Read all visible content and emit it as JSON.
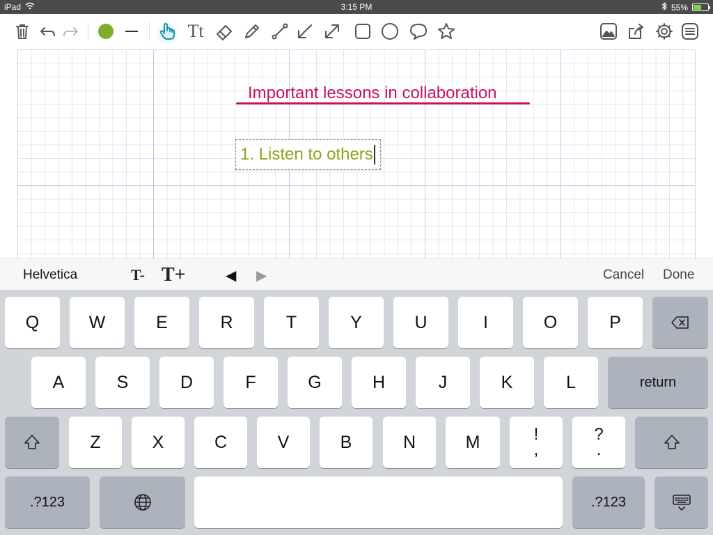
{
  "status_bar": {
    "device": "iPad",
    "time": "3:15 PM",
    "battery": "55%",
    "battery_level": 0.55
  },
  "toolbar": {
    "icons": [
      "trash-icon",
      "undo-icon",
      "redo-icon",
      "color-picker",
      "stroke-width",
      "hand-pointer-icon",
      "text-tool-icon",
      "eraser-icon",
      "pencil-icon",
      "line-icon",
      "arrow-icon",
      "double-arrow-icon",
      "rectangle-icon",
      "circle-icon",
      "speech-bubble-icon",
      "star-icon",
      "image-icon",
      "share-icon",
      "gear-icon",
      "menu-icon"
    ],
    "text_tool_label": "Tt",
    "current_color": "#7fac2a"
  },
  "canvas": {
    "title": "Important lessons in collaboration",
    "title_color": "#c5125f",
    "editing_text": "1. Listen to others",
    "editing_text_color": "#8aa51c"
  },
  "text_accessory": {
    "font_name": "Helvetica",
    "decrease_label": "T-",
    "increase_label": "T+",
    "prev_label": "◀",
    "next_label": "▶",
    "cancel_label": "Cancel",
    "done_label": "Done"
  },
  "keyboard": {
    "row1": [
      "Q",
      "W",
      "E",
      "R",
      "T",
      "Y",
      "U",
      "I",
      "O",
      "P"
    ],
    "row2": [
      "A",
      "S",
      "D",
      "F",
      "G",
      "H",
      "J",
      "K",
      "L"
    ],
    "row3": [
      "Z",
      "X",
      "C",
      "V",
      "B",
      "N",
      "M"
    ],
    "punct1_top": "!",
    "punct1_bottom": ",",
    "punct2_top": "?",
    "punct2_bottom": ".",
    "return_label": "return",
    "numbers_label": ".?123"
  }
}
